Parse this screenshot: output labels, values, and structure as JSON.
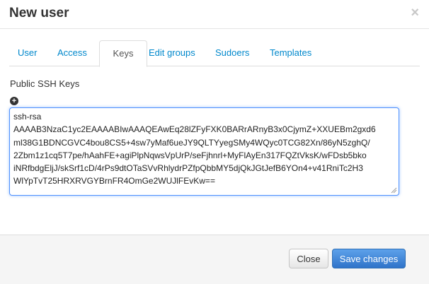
{
  "modal": {
    "title": "New user",
    "close_glyph": "×"
  },
  "tabs": [
    {
      "label": "User",
      "active": false
    },
    {
      "label": "Access",
      "active": false
    },
    {
      "label": "Keys",
      "active": true
    },
    {
      "label": "Edit groups",
      "active": false
    },
    {
      "label": "Sudoers",
      "active": false
    },
    {
      "label": "Templates",
      "active": false
    }
  ],
  "keys": {
    "label": "Public SSH Keys",
    "add_icon": "plus-circle-icon",
    "value": "ssh-rsa\nAAAAB3NzaC1yc2EAAAABIwAAAQEAwEq28lZFyFXK0BARrARnyB3x0CjymZ+XXUEBm2gxd6\nml38G1BDNCGVC4bou8CS5+4sw7yMaf6ueJY9QLTYyegSMy4WQyc0TCG82Xn/86yN5zghQ/\n2Zbm1z1cq5T7pe/hAahFE+agiPlpNqwsVpUrP/seFjhnrl+MyFlAyEn317FQZtVksK/wFDsb5bko\niNRfbdgEljJ/skSrf1cD/4rPs9dtOTaSVvRhlydrPZfpQbbMY5djQkJGtJefB6YOn4+v41RniTc2H3\nWlYpTvT25HRXRVGYBrnFR4OmGe2WUJlFEvKw=="
  },
  "footer": {
    "close_label": "Close",
    "save_label": "Save changes"
  },
  "colors": {
    "link": "#0088cc",
    "primary": "#3a7fd6",
    "focus": "#4d90fe"
  }
}
